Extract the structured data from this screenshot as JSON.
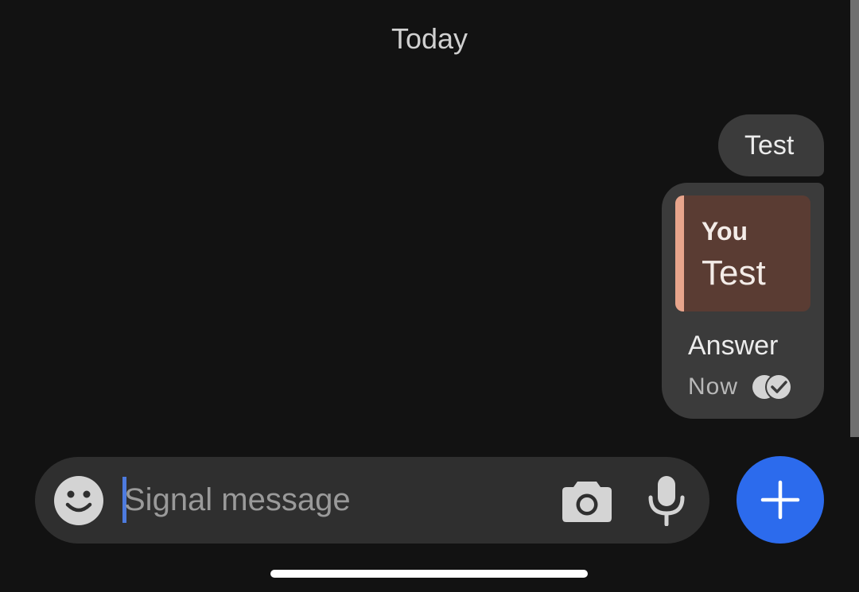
{
  "conversation": {
    "date_header": "Today",
    "messages": [
      {
        "text": "Test"
      },
      {
        "quote": {
          "author": "You",
          "text": "Test"
        },
        "text": "Answer",
        "time": "Now",
        "status_icon": "read-receipt-icon"
      }
    ]
  },
  "composer": {
    "placeholder": "Signal message",
    "emoji_icon": "emoji-icon",
    "camera_icon": "camera-icon",
    "mic_icon": "microphone-icon",
    "add_icon": "plus-icon"
  },
  "colors": {
    "background": "#121212",
    "bubble": "#3b3b3b",
    "quote_background": "#5a3c33",
    "quote_accent": "#e8a58c",
    "accent": "#2c6bed",
    "caret": "#4d7bdf"
  }
}
